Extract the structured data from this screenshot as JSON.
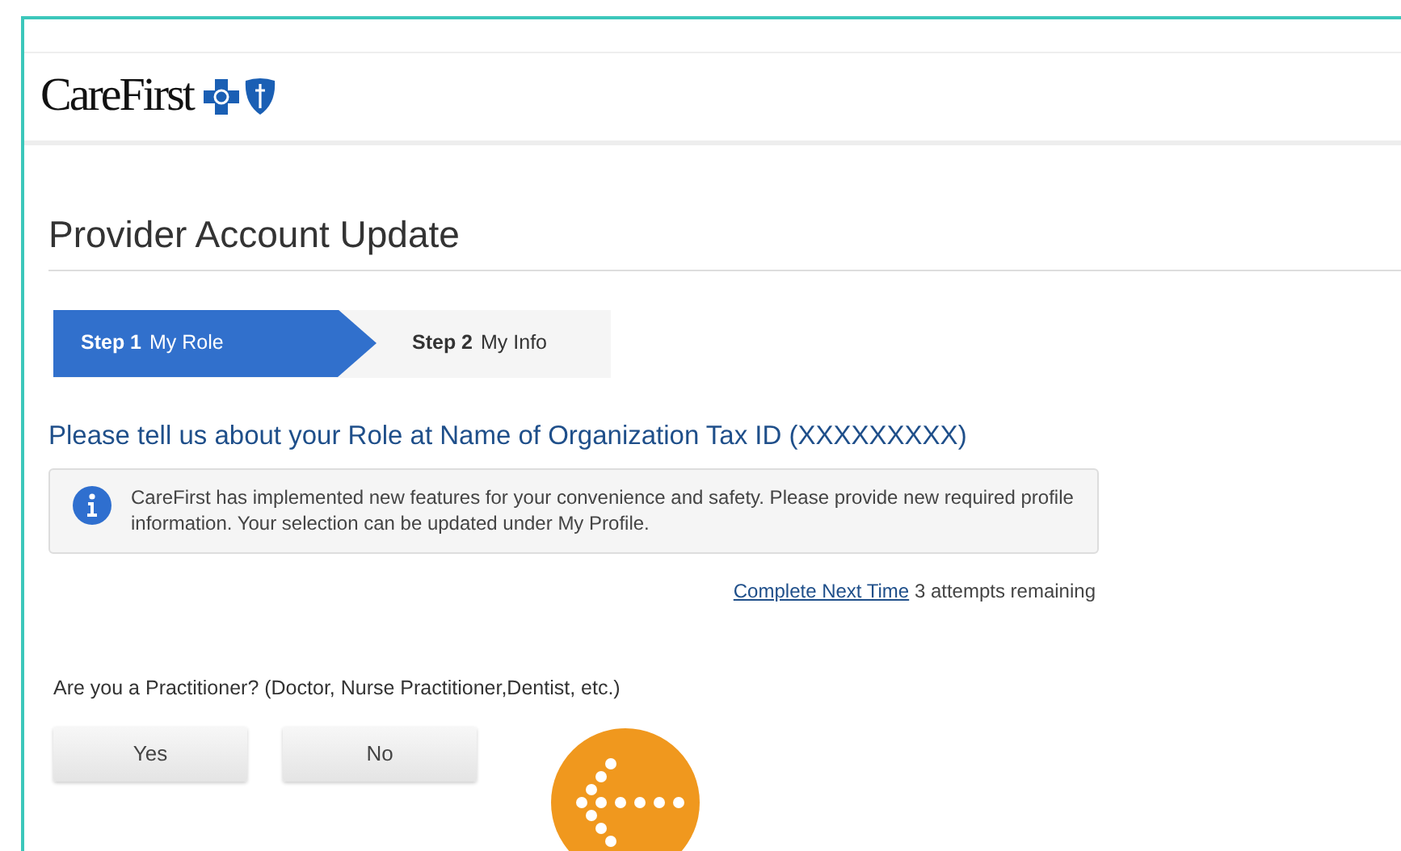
{
  "header": {
    "logo_text": "CareFirst"
  },
  "page_title": "Provider Account Update",
  "steps": [
    {
      "number": "Step 1",
      "label": "My Role",
      "selected": true
    },
    {
      "number": "Step 2",
      "label": "My Info",
      "selected": false
    }
  ],
  "heading": "Please tell us about your Role at Name of Organization Tax ID (XXXXXXXXX)",
  "info_message": "CareFirst has implemented new features for your convenience and safety. Please provide new required profile information. Your selection can be updated under My Profile.",
  "defer": {
    "link": "Complete Next Time",
    "note": "3 attempts remaining"
  },
  "question": "Are you a Practitioner? (Doctor, Nurse Practitioner,Dentist, etc.)",
  "buttons": [
    "Yes",
    "No"
  ]
}
